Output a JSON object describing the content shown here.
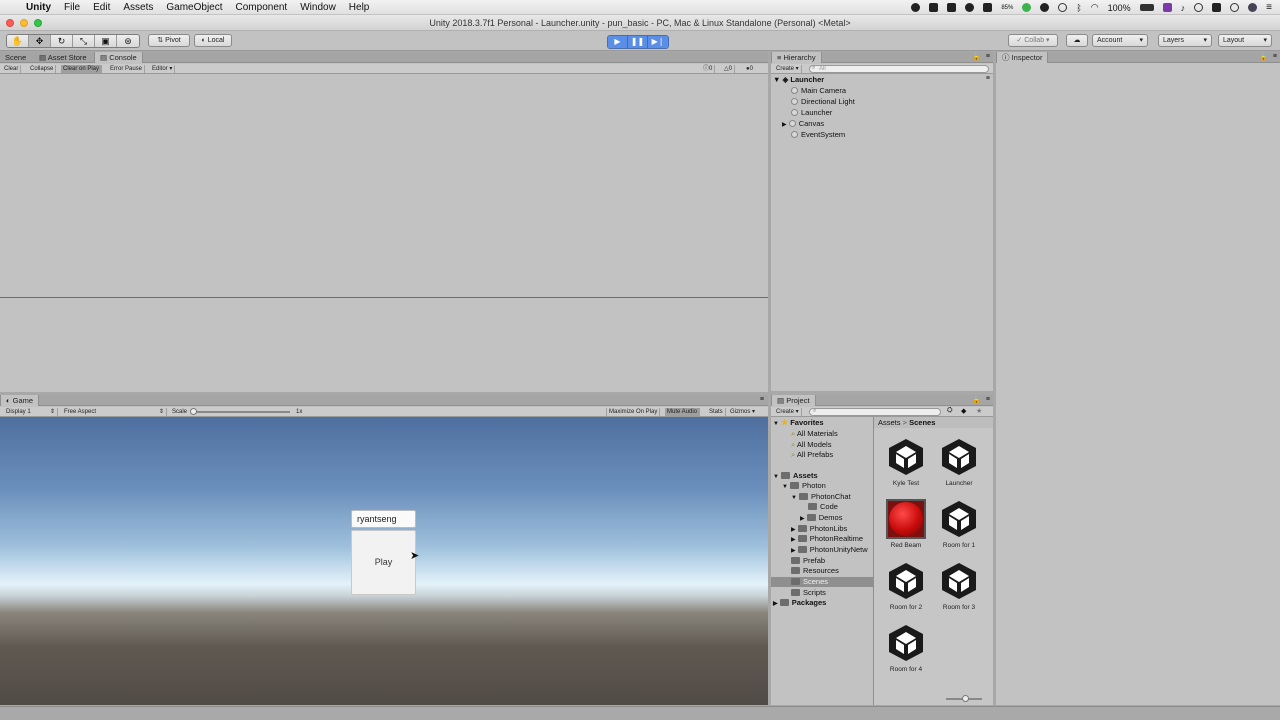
{
  "menubar": {
    "app": "Unity",
    "items": [
      "File",
      "Edit",
      "Assets",
      "GameObject",
      "Component",
      "Window",
      "Help"
    ],
    "battery": "100%",
    "status_badge": "85%"
  },
  "window": {
    "title": "Unity 2018.3.7f1 Personal - Launcher.unity - pun_basic - PC, Mac & Linux Standalone (Personal) <Metal>"
  },
  "toolbar": {
    "pivot": "Pivot",
    "local": "Local",
    "collab": "Collab",
    "account": "Account",
    "layers": "Layers",
    "layout": "Layout"
  },
  "console": {
    "tabs": [
      "Scene",
      "Asset Store",
      "Console"
    ],
    "buttons": [
      "Clear",
      "Collapse",
      "Clear on Play",
      "Error Pause",
      "Editor"
    ],
    "counts": [
      "0",
      "0",
      "0"
    ]
  },
  "game": {
    "tab": "Game",
    "display": "Display 1",
    "aspect": "Free Aspect",
    "scale_label": "Scale",
    "scale_value": "1x",
    "options": [
      "Maximize On Play",
      "Mute Audio",
      "Stats",
      "Gizmos"
    ],
    "input_value": "ryantseng",
    "play_label": "Play"
  },
  "hierarchy": {
    "tab": "Hierarchy",
    "create": "Create",
    "search_placeholder": "All",
    "scene": "Launcher",
    "items": [
      "Main Camera",
      "Directional Light",
      "Launcher",
      "Canvas",
      "EventSystem"
    ]
  },
  "inspector": {
    "tab": "Inspector"
  },
  "project": {
    "tab": "Project",
    "create": "Create",
    "favorites": "Favorites",
    "fav_items": [
      "All Materials",
      "All Models",
      "All Prefabs"
    ],
    "assets_root": "Assets",
    "tree": [
      "Photon",
      "PhotonChat",
      "Code",
      "Demos",
      "PhotonLibs",
      "PhotonRealtime",
      "PhotonUnityNetw",
      "Prefab",
      "Resources",
      "Scenes",
      "Scripts"
    ],
    "packages": "Packages",
    "breadcrumb": [
      "Assets",
      "Scenes"
    ],
    "assets": [
      "Kyle Test",
      "Launcher",
      "Red Beam",
      "Room for 1",
      "Room for 2",
      "Room for 3",
      "Room for 4"
    ]
  }
}
